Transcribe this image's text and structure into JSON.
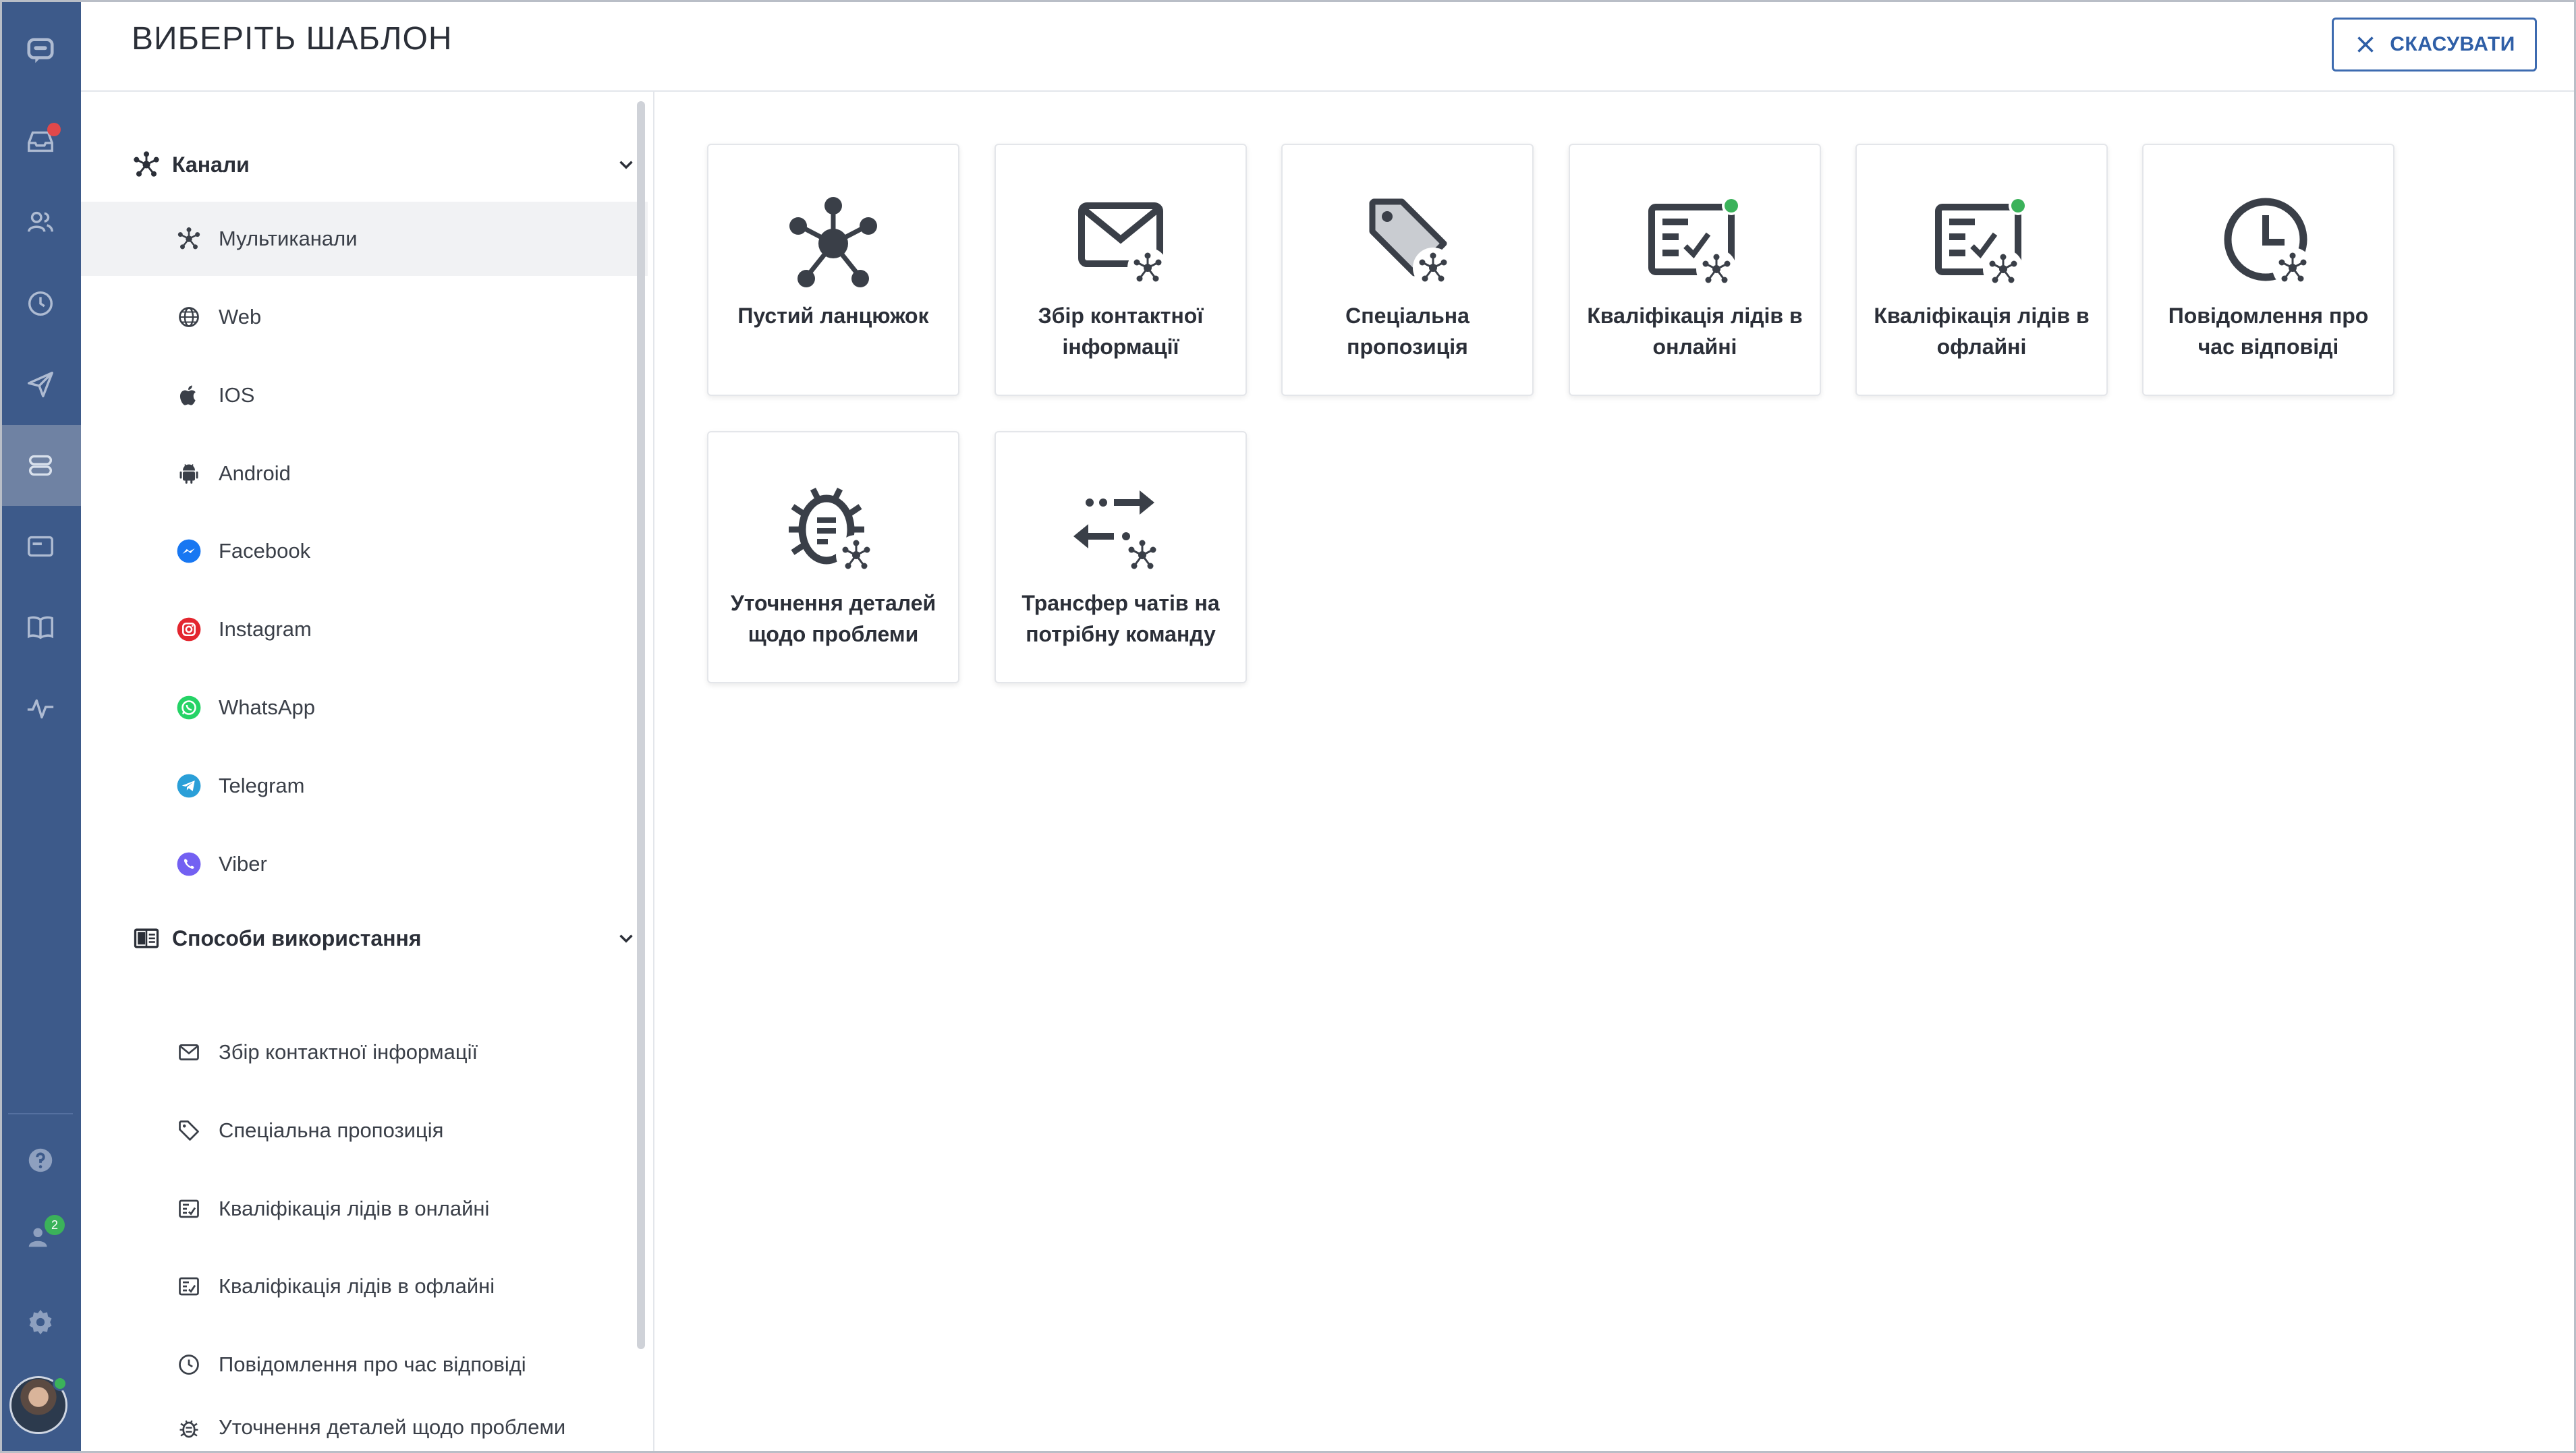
{
  "header": {
    "title": "ВИБЕРІТЬ ШАБЛОН",
    "cancel_label": "СКАСУВАТИ"
  },
  "rail": {
    "items": [
      {
        "icon": "chat-logo-icon"
      },
      {
        "icon": "inbox-icon"
      },
      {
        "icon": "contacts-icon"
      },
      {
        "icon": "history-icon"
      },
      {
        "icon": "send-icon"
      },
      {
        "icon": "bot-icon"
      },
      {
        "icon": "widget-icon"
      },
      {
        "icon": "knowledge-base-icon"
      },
      {
        "icon": "analytics-icon"
      },
      {
        "icon": "help-icon"
      },
      {
        "icon": "team-icon",
        "badge": "2"
      },
      {
        "icon": "settings-icon"
      }
    ]
  },
  "sidebar": {
    "groups": [
      {
        "label": "Канали",
        "items": [
          {
            "label": "Мультиканали",
            "active": true
          },
          {
            "label": "Web"
          },
          {
            "label": "IOS"
          },
          {
            "label": "Android"
          },
          {
            "label": "Facebook"
          },
          {
            "label": "Instagram"
          },
          {
            "label": "WhatsApp"
          },
          {
            "label": "Telegram"
          },
          {
            "label": "Viber"
          }
        ]
      },
      {
        "label": "Способи використання",
        "items": [
          {
            "label": "Збір контактної інформації"
          },
          {
            "label": "Спеціальна пропозиція"
          },
          {
            "label": "Кваліфікація лідів в онлайні"
          },
          {
            "label": "Кваліфікація лідів в офлайні"
          },
          {
            "label": "Повідомлення про час відповіді"
          },
          {
            "label": "Уточнення деталей щодо проблеми"
          }
        ]
      }
    ]
  },
  "templates": [
    {
      "line1": "Пустий ланцюжок",
      "line2": ""
    },
    {
      "line1": "Збір контактної",
      "line2": "інформації"
    },
    {
      "line1": "Спеціальна",
      "line2": "пропозиція"
    },
    {
      "line1": "Кваліфікація лідів в",
      "line2": "онлайні"
    },
    {
      "line1": "Кваліфікація лідів в",
      "line2": "офлайні"
    },
    {
      "line1": "Повідомлення про",
      "line2": "час відповіді"
    },
    {
      "line1": "Уточнення деталей",
      "line2": "щодо проблеми"
    },
    {
      "line1": "Трансфер чатів на",
      "line2": "потрібну команду"
    }
  ],
  "colors": {
    "rail": "#3d5a8a",
    "accent": "#2f5fa7",
    "online": "#3bb25a",
    "alert": "#e0484a",
    "facebook": "#1877f2",
    "instagram": "#e1306c",
    "whatsapp": "#25d366",
    "telegram": "#2a9fd8",
    "viber": "#7360f2"
  }
}
